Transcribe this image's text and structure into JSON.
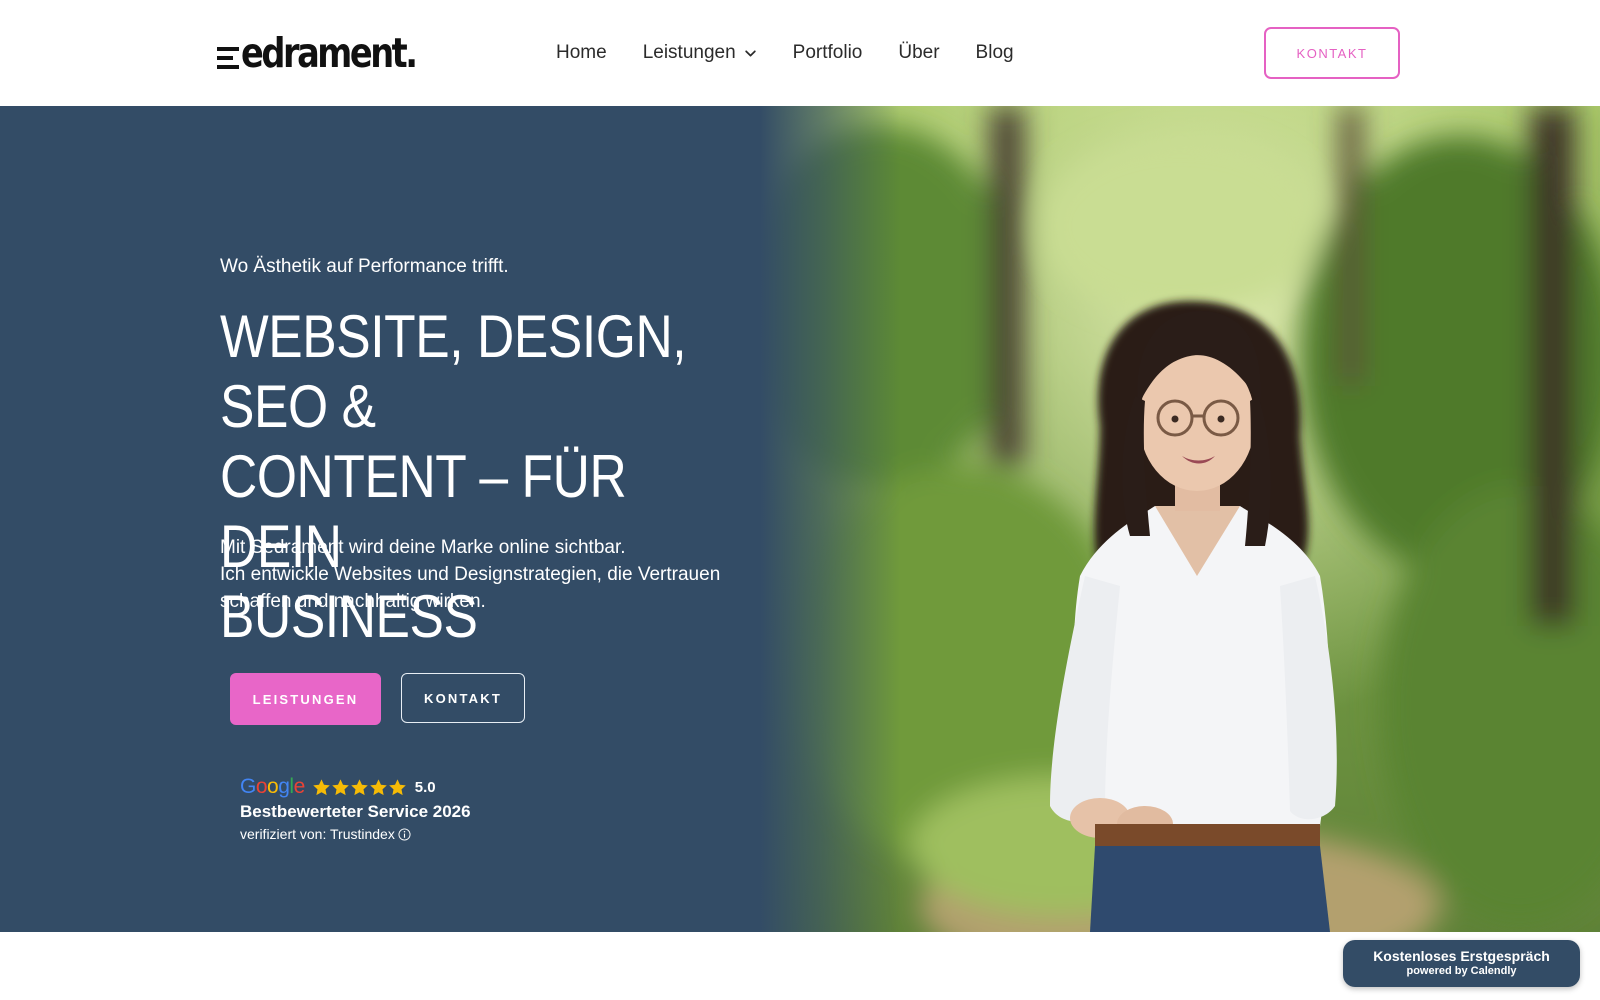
{
  "header": {
    "logo_text": "edrament.",
    "nav": [
      {
        "label": "Home"
      },
      {
        "label": "Leistungen",
        "has_dropdown": true
      },
      {
        "label": "Portfolio"
      },
      {
        "label": "Über"
      },
      {
        "label": "Blog"
      }
    ],
    "cta_label": "KONTAKT"
  },
  "hero": {
    "tagline": "Wo Ästhetik auf Performance trifft.",
    "headline": "WEBSITE, DESIGN, SEO &\nCONTENT – FÜR DEIN\nBUSINESS",
    "intro_line1": "Mit Sedrament wird deine Marke online sichtbar.",
    "intro_line2": "Ich entwickle Websites und Designstrategien, die Vertrauen schaffen und nachhaltig wirken.",
    "primary_button": "LEISTUNGEN",
    "secondary_button": "KONTAKT",
    "image_icon": "portrait-photo"
  },
  "review": {
    "brand": "Google",
    "stars": 5,
    "rating": "5.0",
    "title": "Bestbewerteter Service 2026",
    "verified": "verifiziert von: Trustindex"
  },
  "calendly": {
    "title": "Kostenloses Erstgespräch",
    "subtitle": "powered by Calendly"
  },
  "colors": {
    "hero_bg": "#334c66",
    "accent_pink": "#e866c8",
    "star_gold": "#f6bb06"
  }
}
